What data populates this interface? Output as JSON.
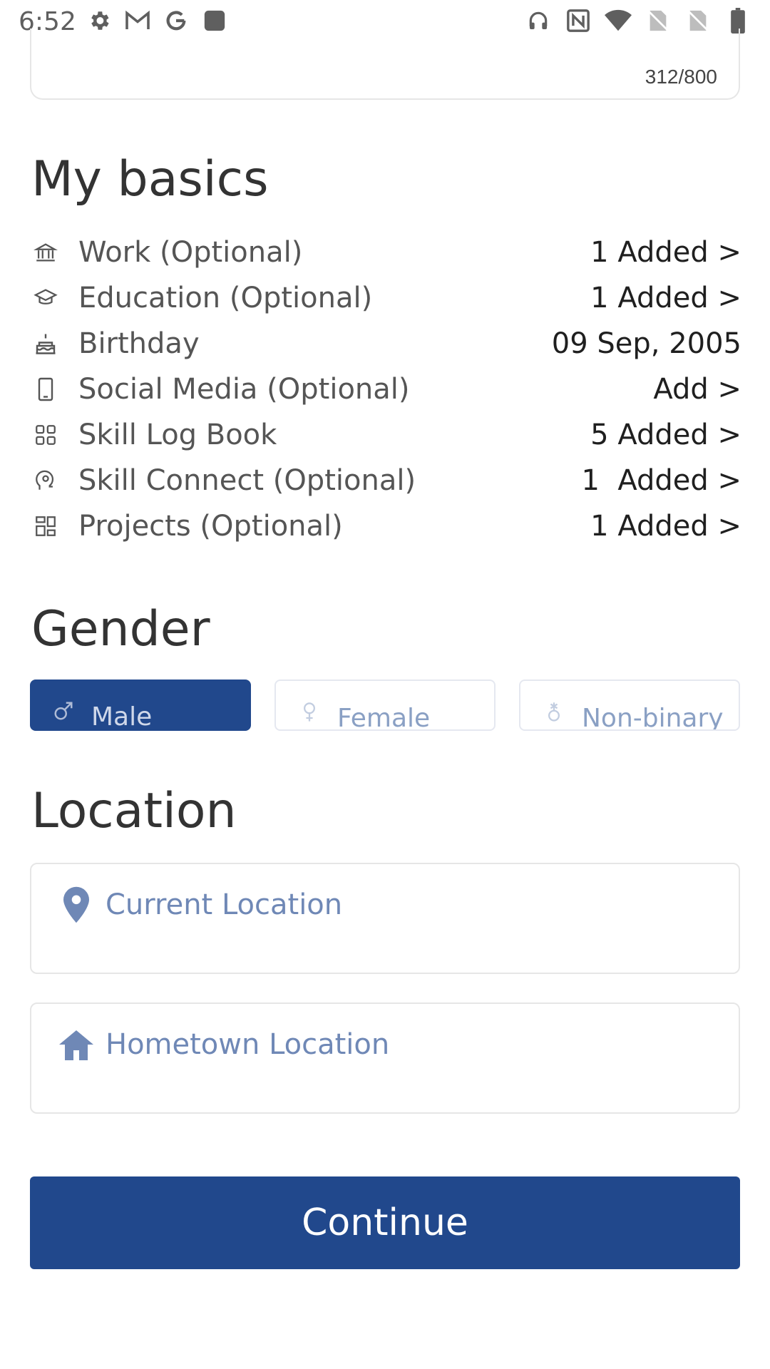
{
  "status_bar": {
    "time": "6:52",
    "left_icons": [
      "settings-icon",
      "gmail-icon",
      "google-icon",
      "app-icon"
    ],
    "right_icons": [
      "headset-icon",
      "nfc-icon",
      "wifi-icon",
      "no-sim-icon",
      "no-sim-icon",
      "battery-icon"
    ]
  },
  "about": {
    "char_count": "312/800"
  },
  "basics": {
    "title": "My basics",
    "items": [
      {
        "icon": "bank-icon",
        "label": "Work (Optional)",
        "value": "1 Added >"
      },
      {
        "icon": "graduation-cap-icon",
        "label": "Education (Optional)",
        "value": "1 Added >"
      },
      {
        "icon": "cake-icon",
        "label": "Birthday",
        "value": "09 Sep, 2005"
      },
      {
        "icon": "phone-icon",
        "label": "Social Media (Optional)",
        "value": "Add >"
      },
      {
        "icon": "grid-icon",
        "label": "Skill Log Book",
        "value": "5 Added >"
      },
      {
        "icon": "head-bulb-icon",
        "label": "Skill Connect (Optional)",
        "value": "1  Added >"
      },
      {
        "icon": "projects-icon",
        "label": "Projects (Optional)",
        "value": "1 Added >"
      }
    ]
  },
  "gender": {
    "title": "Gender",
    "options": [
      {
        "icon": "male-icon",
        "label": "Male",
        "selected": true
      },
      {
        "icon": "female-icon",
        "label": "Female",
        "selected": false
      },
      {
        "icon": "nonbinary-icon",
        "label": "Non-binary",
        "selected": false
      }
    ]
  },
  "location": {
    "title": "Location",
    "current_placeholder": "Current Location",
    "hometown_placeholder": "Hometown Location"
  },
  "continue_label": "Continue",
  "colors": {
    "primary": "#21488c",
    "placeholder": "#6f88b6",
    "border": "#e6e6e6"
  }
}
